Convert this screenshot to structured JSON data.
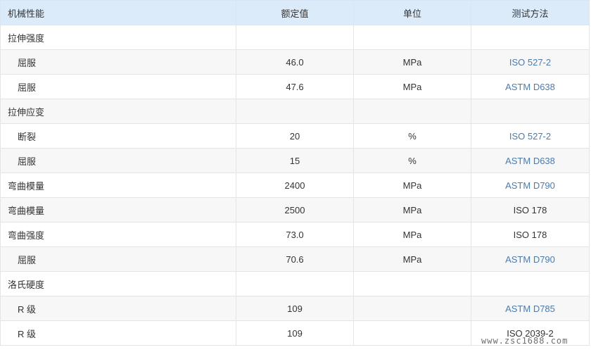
{
  "table": {
    "headers": {
      "property": "机械性能",
      "value": "额定值",
      "unit": "单位",
      "method": "测试方法"
    },
    "rows": [
      {
        "property": "拉伸强度",
        "sub": false,
        "value": "",
        "unit": "",
        "method": "",
        "method_link": false
      },
      {
        "property": "屈服",
        "sub": true,
        "value": "46.0",
        "unit": "MPa",
        "method": "ISO 527-2",
        "method_link": true
      },
      {
        "property": "屈服",
        "sub": true,
        "value": "47.6",
        "unit": "MPa",
        "method": "ASTM D638",
        "method_link": true
      },
      {
        "property": "拉伸应变",
        "sub": false,
        "value": "",
        "unit": "",
        "method": "",
        "method_link": false
      },
      {
        "property": "断裂",
        "sub": true,
        "value": "20",
        "unit": "%",
        "method": "ISO 527-2",
        "method_link": true
      },
      {
        "property": "屈服",
        "sub": true,
        "value": "15",
        "unit": "%",
        "method": "ASTM D638",
        "method_link": true
      },
      {
        "property": "弯曲模量",
        "sub": false,
        "value": "2400",
        "unit": "MPa",
        "method": "ASTM D790",
        "method_link": true
      },
      {
        "property": "弯曲模量",
        "sub": false,
        "value": "2500",
        "unit": "MPa",
        "method": "ISO 178",
        "method_link": false
      },
      {
        "property": "弯曲强度",
        "sub": false,
        "value": "73.0",
        "unit": "MPa",
        "method": "ISO 178",
        "method_link": false
      },
      {
        "property": "屈服",
        "sub": true,
        "value": "70.6",
        "unit": "MPa",
        "method": "ASTM D790",
        "method_link": true
      },
      {
        "property": "洛氏硬度",
        "sub": false,
        "value": "",
        "unit": "",
        "method": "",
        "method_link": false
      },
      {
        "property": "R 级",
        "sub": true,
        "value": "109",
        "unit": "",
        "method": "ASTM D785",
        "method_link": true
      },
      {
        "property": "R 级",
        "sub": true,
        "value": "109",
        "unit": "",
        "method": "ISO 2039-2",
        "method_link": false
      }
    ]
  },
  "watermark": "www.zsc1688.com",
  "colors": {
    "header_bg": "#dcebfa",
    "link": "#4a7bb0",
    "text": "#333333",
    "stripe": "#f7f7f7",
    "border": "#e4e4e4"
  }
}
